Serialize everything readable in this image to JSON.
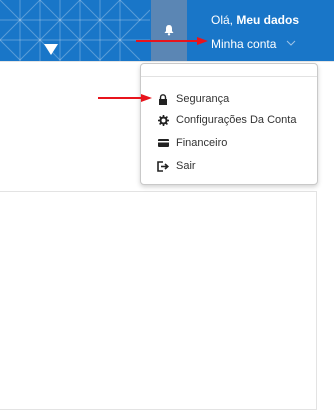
{
  "header": {
    "greeting_prefix": "Olá, ",
    "greeting_name": "Meu dados",
    "account_link": "Minha conta",
    "background_color": "#1976c8",
    "bell_box_color": "#5b86b4"
  },
  "dropdown": {
    "items": [
      {
        "label": "Segurança",
        "icon": "lock-icon"
      },
      {
        "label": "Configurações Da Conta",
        "icon": "gear-icon"
      },
      {
        "label": "Financeiro",
        "icon": "credit-card-icon"
      },
      {
        "label": "Sair",
        "icon": "logout-icon"
      }
    ]
  },
  "annotations": {
    "arrow_color": "#e8141c"
  }
}
